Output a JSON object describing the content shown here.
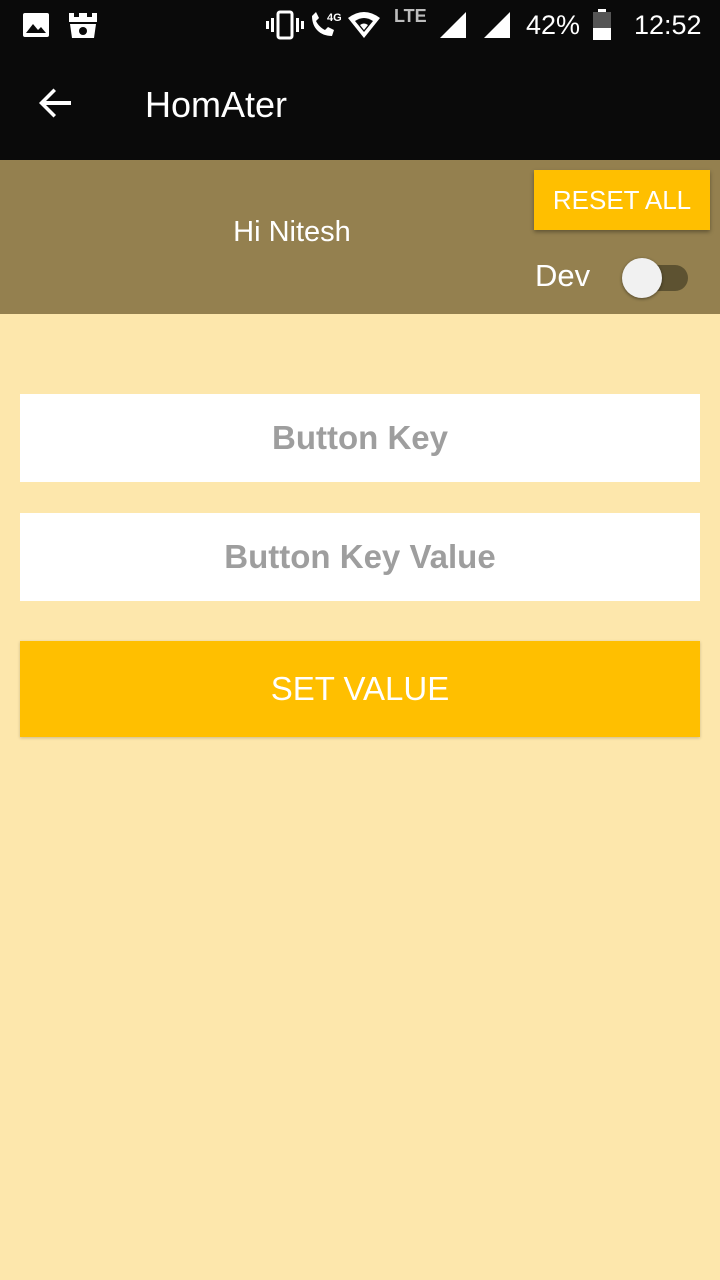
{
  "status_bar": {
    "network_type": "LTE",
    "data_type": "4G",
    "battery": "42%",
    "time": "12:52",
    "icons": [
      "image-icon",
      "app-notification-icon",
      "vibrate-icon",
      "call-4g-icon",
      "wifi-icon",
      "signal-icon",
      "signal-icon",
      "battery-icon"
    ]
  },
  "app_bar": {
    "title": "HomAter",
    "back_icon": "arrow-back-icon"
  },
  "header": {
    "greeting": "Hi Nitesh",
    "reset_label": "RESET ALL",
    "dev_label": "Dev",
    "dev_enabled": false
  },
  "form": {
    "key_placeholder": "Button Key",
    "value_placeholder": "Button Key Value",
    "set_label": "SET VALUE"
  },
  "colors": {
    "background": "#fde7ac",
    "header": "#94804f",
    "accent": "#ffbf00",
    "toolbar": "#0a0a0a"
  }
}
